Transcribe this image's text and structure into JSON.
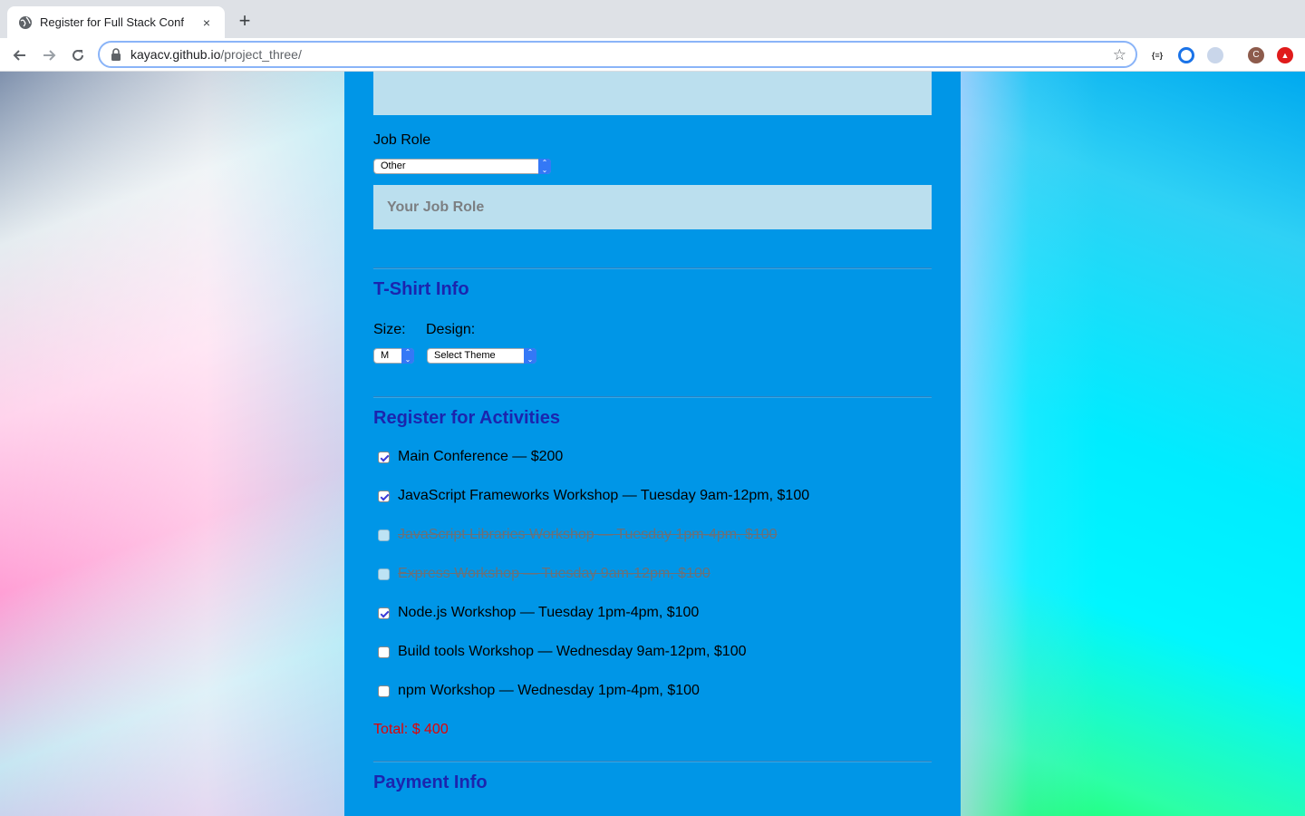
{
  "browser": {
    "tab_title": "Register for Full Stack Conf",
    "tab_close": "×",
    "new_tab": "+",
    "url_host": "kayacv.github.io",
    "url_path": "/project_three/"
  },
  "form": {
    "job_role_label": "Job Role",
    "job_role_value": "Other",
    "job_role_placeholder": "Your Job Role",
    "tshirt_title": "T-Shirt Info",
    "size_label": "Size:",
    "size_value": "M",
    "design_label": "Design:",
    "design_value": "Select Theme",
    "activities_title": "Register for Activities",
    "activities": [
      {
        "label": "Main Conference — $200",
        "checked": true,
        "disabled": false
      },
      {
        "label": "JavaScript Frameworks Workshop — Tuesday 9am-12pm, $100",
        "checked": true,
        "disabled": false
      },
      {
        "label": "JavaScript Libraries Workshop — Tuesday 1pm-4pm, $100",
        "checked": false,
        "disabled": true
      },
      {
        "label": "Express Workshop — Tuesday 9am-12pm, $100",
        "checked": false,
        "disabled": true
      },
      {
        "label": "Node.js Workshop — Tuesday 1pm-4pm, $100",
        "checked": true,
        "disabled": false
      },
      {
        "label": "Build tools Workshop — Wednesday 9am-12pm, $100",
        "checked": false,
        "disabled": false
      },
      {
        "label": "npm Workshop — Wednesday 1pm-4pm, $100",
        "checked": false,
        "disabled": false
      }
    ],
    "total": "Total: $ 400",
    "payment_title": "Payment Info"
  },
  "colors": {
    "panel": "#0096e7",
    "section_title": "#1b25ae",
    "total": "#e60000"
  }
}
